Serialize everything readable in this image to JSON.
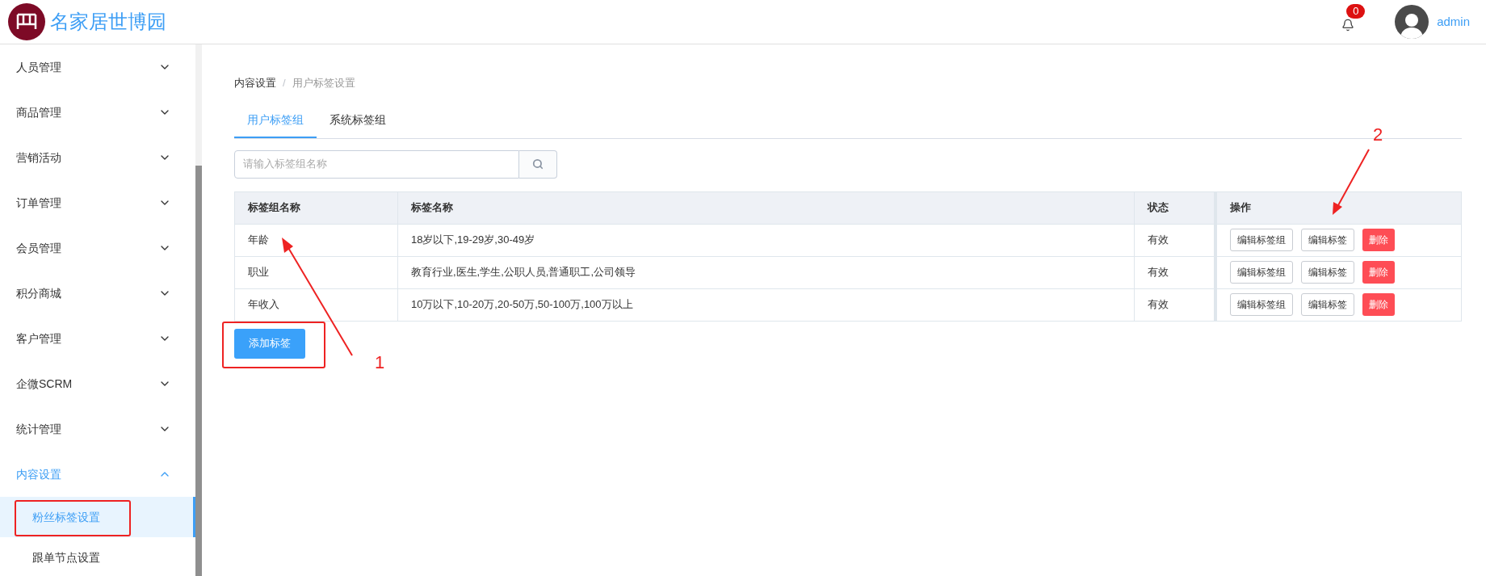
{
  "header": {
    "logo_text": "名家居世博园",
    "notification_count": "0",
    "user": "admin"
  },
  "sidebar": {
    "items": [
      {
        "label": "人员管理",
        "expanded": false
      },
      {
        "label": "商品管理",
        "expanded": false
      },
      {
        "label": "营销活动",
        "expanded": false
      },
      {
        "label": "订单管理",
        "expanded": false
      },
      {
        "label": "会员管理",
        "expanded": false
      },
      {
        "label": "积分商城",
        "expanded": false
      },
      {
        "label": "客户管理",
        "expanded": false
      },
      {
        "label": "企微SCRM",
        "expanded": false
      },
      {
        "label": "统计管理",
        "expanded": false
      },
      {
        "label": "内容设置",
        "expanded": true,
        "children": [
          {
            "label": "粉丝标签设置",
            "selected": true
          },
          {
            "label": "跟单节点设置",
            "selected": false
          }
        ]
      }
    ]
  },
  "breadcrumb": [
    "内容设置",
    "用户标签设置"
  ],
  "breadcrumb_separator": "/",
  "tabs": [
    {
      "label": "用户标签组",
      "selected": true
    },
    {
      "label": "系统标签组",
      "selected": false
    }
  ],
  "search": {
    "placeholder": "请输入标签组名称"
  },
  "table": {
    "columns": [
      "标签组名称",
      "标签名称",
      "状态",
      "操作"
    ],
    "rows": [
      {
        "group": "年龄",
        "tags": "18岁以下,19-29岁,30-49岁",
        "status": "有效",
        "actions": [
          "编辑标签组",
          "编辑标签",
          "删除"
        ]
      },
      {
        "group": "职业",
        "tags": "教育行业,医生,学生,公职人员,普通职工,公司领导",
        "status": "有效",
        "actions": [
          "编辑标签组",
          "编辑标签",
          "删除"
        ]
      },
      {
        "group": "年收入",
        "tags": "10万以下,10-20万,20-50万,50-100万,100万以上",
        "status": "有效",
        "actions": [
          "编辑标签组",
          "编辑标签",
          "删除"
        ]
      }
    ]
  },
  "add_button": "添加标签",
  "annotations": [
    "1",
    "2"
  ]
}
